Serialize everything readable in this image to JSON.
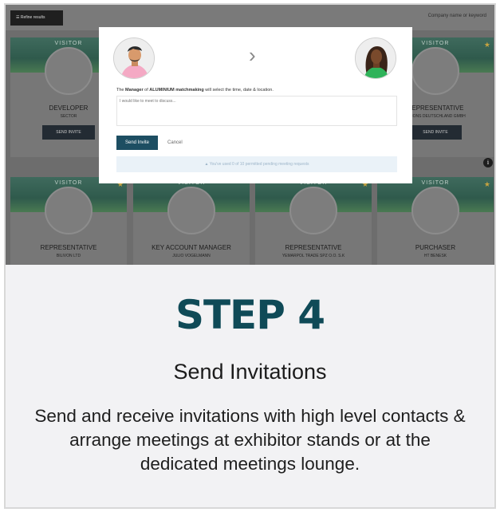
{
  "screenshot": {
    "refine_label": "☰ Refine results",
    "search_placeholder": "Company name or keyword",
    "cards_top": [
      {
        "visitor": "VISITOR",
        "role": "DEVELOPER",
        "company": "SECTOR",
        "invite": "SEND INVITE"
      },
      {
        "visitor": "VISITOR",
        "role": "REPRESENTATIVE",
        "company": "RITIONS DEUTSCHLAND GMBH",
        "invite": "SEND INVITE"
      }
    ],
    "cards_bottom": [
      {
        "visitor": "VISITOR",
        "role": "REPRESENTATIVE",
        "company": "BILIVON LTD"
      },
      {
        "visitor": "VISITOR",
        "role": "KEY ACCOUNT MANAGER",
        "company": "JULIO VOGELMANN"
      },
      {
        "visitor": "VISITOR",
        "role": "REPRESENTATIVE",
        "company": "YEMARPOL TRADE SPZ O.O. S.K"
      },
      {
        "visitor": "VISITOR",
        "role": "PURCHASER",
        "company": "HT BENESK"
      }
    ],
    "modal": {
      "desc_prefix": "The ",
      "desc_role": "Manager",
      "desc_mid": " of ",
      "desc_company": "ALUMINIUM matchmaking",
      "desc_suffix": " will select the time, date & location.",
      "message_placeholder": "I would like to meet to discuss...",
      "send_label": "Send Invite",
      "cancel_label": "Cancel",
      "notice": "▲  You've used 0 of 10 permitted pending meeting requests"
    },
    "info_glyph": "i"
  },
  "step": {
    "title": "STEP 4",
    "subtitle": "Send Invitations",
    "body": "Send and receive invitations with high level contacts & arrange meetings at exhibitor stands or at the dedicated meetings lounge."
  },
  "colors": {
    "accent": "#0f4a57",
    "button": "#1d4e62"
  }
}
